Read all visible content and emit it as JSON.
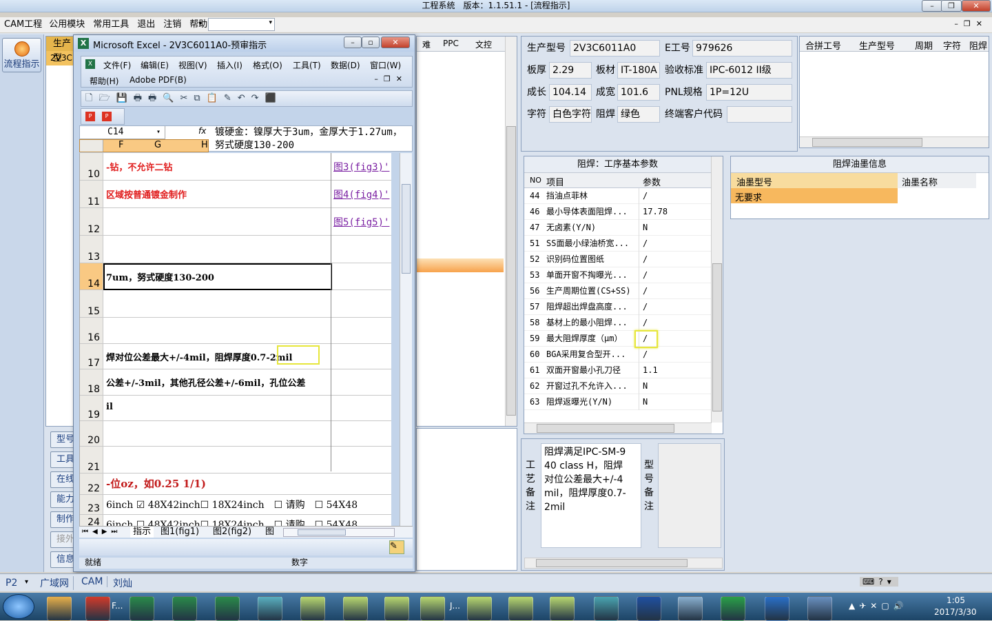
{
  "window": {
    "title": "工程系统　版本：1.1.51.1 - [流程指示]"
  },
  "menubar": {
    "items": [
      "CAM工程",
      "公用模块",
      "常用工具",
      "退出",
      "注销",
      "帮助"
    ],
    "combo": ""
  },
  "left_panel": {
    "btn_label": "流程指示"
  },
  "back_list": {
    "header": "生产型",
    "row1": "2V3C",
    "side_btns": [
      "型号",
      "工具",
      "在线",
      "能力",
      "制作",
      "接外",
      "信息"
    ]
  },
  "mid_grid": {
    "cols": [
      "难",
      "PPC",
      "文控"
    ]
  },
  "excel": {
    "title": "Microsoft Excel - 2V3C6011A0-预审指示",
    "menu": [
      "文件(F)",
      "编辑(E)",
      "视图(V)",
      "插入(I)",
      "格式(O)",
      "工具(T)",
      "数据(D)",
      "窗口(W)",
      "帮助(H)",
      "Adobe PDF(B)"
    ],
    "namebox": "C14",
    "fx": "fx",
    "formula": "镀硬金：镍厚大于3um，金厚大于1.27um，努式硬度130-200",
    "cols": [
      "F",
      "G",
      "H"
    ],
    "rows": [
      {
        "n": "10",
        "text": "-钻，不允许二钻",
        "link": "图3(fig3)'",
        "red": true
      },
      {
        "n": "11",
        "text": "区域按普通镀金制作",
        "link": "图4(fig4)'",
        "red": true
      },
      {
        "n": "12",
        "text": "",
        "link": "图5(fig5)'"
      },
      {
        "n": "13",
        "text": "",
        "link": ""
      },
      {
        "n": "14",
        "text": "7um，努式硬度130-200",
        "link": ""
      },
      {
        "n": "15",
        "text": "",
        "link": ""
      },
      {
        "n": "16",
        "text": "",
        "link": ""
      },
      {
        "n": "17",
        "text": "焊对位公差最大+/-4mil，阻焊厚度0.7-2mil",
        "link": ""
      },
      {
        "n": "18",
        "text": " 公差+/-3mil，其他孔径公差+/-6mil，孔位公差",
        "link": ""
      },
      {
        "n": "19",
        "text": "il",
        "link": ""
      },
      {
        "n": "20",
        "text": "",
        "link": ""
      },
      {
        "n": "21",
        "text": "",
        "link": ""
      },
      {
        "n": "22",
        "text": "-位oz，如0.25 1/1)",
        "link": ""
      },
      {
        "n": "23",
        "text": "6inch ☑ 48X42inch☐ 18X24inch　☐ 请购　☐ 54X48",
        "link": ""
      },
      {
        "n": "24",
        "text": "6inch ☐ 48X42inch☐ 18X24inch　☐ 请购　☐ 54X48",
        "link": ""
      }
    ],
    "sheets": [
      "指示",
      "图1(fig1)",
      "图2(fig2)",
      "图"
    ],
    "status": "就绪",
    "status2": "数字"
  },
  "info": {
    "fields": [
      {
        "label": "生产型号",
        "value": "2V3C6011A0"
      },
      {
        "label": "E工号",
        "value": "979626"
      },
      {
        "label": "板厚",
        "value": "2.29"
      },
      {
        "label": "板材",
        "value": "IT-180A"
      },
      {
        "label": "验收标准",
        "value": "IPC-6012 II级"
      },
      {
        "label": "成长",
        "value": "104.14"
      },
      {
        "label": "成宽",
        "value": "101.6"
      },
      {
        "label": "PNL规格",
        "value": "1P=12U"
      },
      {
        "label": "字符",
        "value": "白色字符"
      },
      {
        "label": "阻焊",
        "value": "绿色"
      },
      {
        "label": "终端客户代码",
        "value": ""
      }
    ]
  },
  "merge_table": {
    "cols": [
      "合拼工号",
      "生产型号",
      "周期",
      "字符",
      "阻焊"
    ]
  },
  "params": {
    "title": "阻焊：工序基本参数",
    "cols": [
      "NO",
      "项目",
      "参数"
    ],
    "rows": [
      [
        "44",
        "挡油点菲林",
        "/"
      ],
      [
        "46",
        "最小导体表面阻焊...",
        "17.78"
      ],
      [
        "47",
        "无卤素(Y/N)",
        "N"
      ],
      [
        "51",
        "SS面最小绿油桥宽...",
        "/"
      ],
      [
        "52",
        "识别码位置图纸",
        "/"
      ],
      [
        "53",
        "单面开窗不掏曝光...",
        "/"
      ],
      [
        "56",
        "生产周期位置(CS+SS)",
        "/"
      ],
      [
        "57",
        "阻焊超出焊盘高度...",
        "/"
      ],
      [
        "58",
        "基材上的最小阻焊...",
        "/"
      ],
      [
        "59",
        "最大阻焊厚度（μm）",
        "/"
      ],
      [
        "60",
        "BGA采用复合型开...",
        "/"
      ],
      [
        "61",
        "双面开窗最小孔刀径",
        "1.1"
      ],
      [
        "62",
        "开窗过孔不允许入...",
        "N"
      ],
      [
        "63",
        "阻焊返曝光(Y/N)",
        "N"
      ]
    ]
  },
  "ink": {
    "title": "阻焊油墨信息",
    "cols": [
      "油墨型号",
      "油墨名称"
    ],
    "row": "无要求"
  },
  "craft": {
    "label": "工艺备注",
    "text": "阻焊满足IPC-SM-940 class H，阻焊对位公差最大+/-4mil，阻焊厚度0.7-2mil",
    "label2": "型号备注"
  },
  "statusbar": {
    "p2": "P2",
    "tabs": [
      "广域网",
      "CAM",
      "刘灿"
    ]
  },
  "taskbar": {
    "f_label": "F...",
    "j_label": "J...",
    "time": "1:05",
    "date": "2017/3/30"
  },
  "colors": {
    "accent": "#1e5aa8",
    "title_bar": "#cfe0f3",
    "highlight": "#f7a24c"
  }
}
